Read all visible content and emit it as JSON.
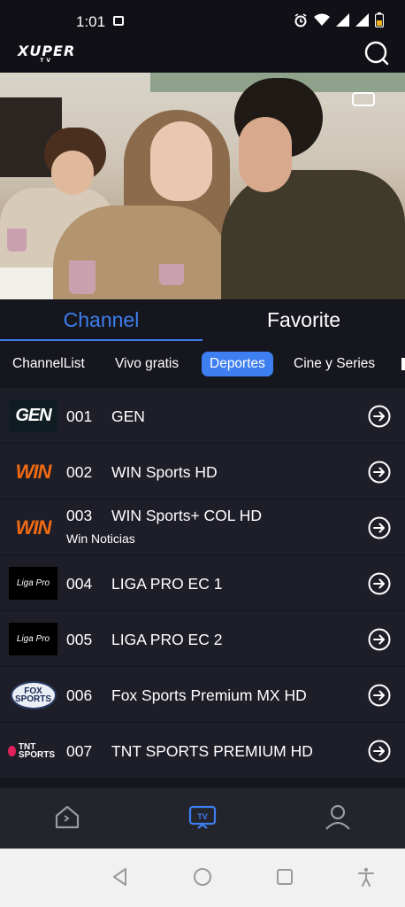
{
  "status_bar": {
    "time": "1:01"
  },
  "header": {
    "logo": "XUPER",
    "logo_sub": "TV"
  },
  "video": {
    "channel_bug": "rcn-logo"
  },
  "main_tabs": [
    {
      "label": "Channel",
      "active": true
    },
    {
      "label": "Favorite",
      "active": false
    }
  ],
  "categories": [
    {
      "label": "ChannelList",
      "active": false
    },
    {
      "label": "Vivo gratis",
      "active": false
    },
    {
      "label": "Deportes",
      "active": true
    },
    {
      "label": "Cine y Series",
      "active": false
    }
  ],
  "channels": [
    {
      "number": "001",
      "name": "GEN",
      "subtitle": "",
      "logo": "GEN"
    },
    {
      "number": "002",
      "name": "WIN Sports HD",
      "subtitle": "",
      "logo": "WIN"
    },
    {
      "number": "003",
      "name": "WIN Sports+ COL HD",
      "subtitle": "Win Noticias",
      "logo": "WIN"
    },
    {
      "number": "004",
      "name": "LIGA PRO EC 1",
      "subtitle": "",
      "logo": "Liga Pro"
    },
    {
      "number": "005",
      "name": "LIGA PRO EC 2",
      "subtitle": "",
      "logo": "Liga Pro"
    },
    {
      "number": "006",
      "name": "Fox Sports Premium MX HD",
      "subtitle": "",
      "logo": "FOX SPORTS"
    },
    {
      "number": "007",
      "name": "TNT SPORTS PREMIUM HD",
      "subtitle": "",
      "logo": "TNT SPORTS"
    }
  ],
  "bottom_nav": [
    {
      "icon": "home-icon",
      "active": false
    },
    {
      "icon": "tv-icon",
      "active": true
    },
    {
      "icon": "profile-icon",
      "active": false
    }
  ],
  "colors": {
    "accent": "#3d7ef0",
    "background": "#16161e",
    "row": "#1e1e28",
    "win_orange": "#f26a12"
  }
}
